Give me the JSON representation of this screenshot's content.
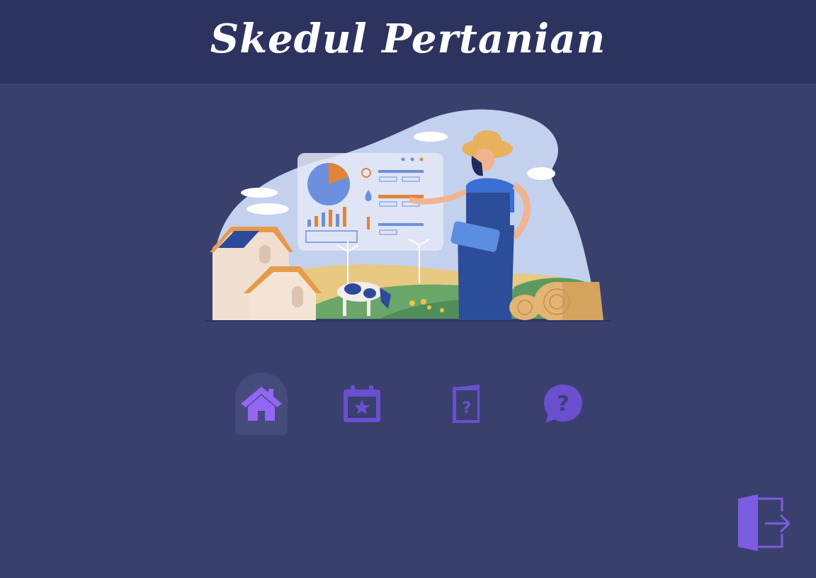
{
  "header": {
    "title": "Skedul Pertanian"
  },
  "hero": {
    "icon": "farmer-dashboard-illustration"
  },
  "nav": {
    "items": [
      {
        "icon": "home-icon",
        "active": true
      },
      {
        "icon": "calendar-star-icon",
        "active": false
      },
      {
        "icon": "help-book-icon",
        "active": false
      },
      {
        "icon": "question-bubble-icon",
        "active": false
      }
    ]
  },
  "logout": {
    "icon": "logout-door-icon"
  },
  "colors": {
    "background": "#3a406e",
    "header": "#2d335f",
    "accent": "#7c5ce0",
    "active_icon": "#9466f5",
    "active_tab_bg": "#454b7a"
  }
}
